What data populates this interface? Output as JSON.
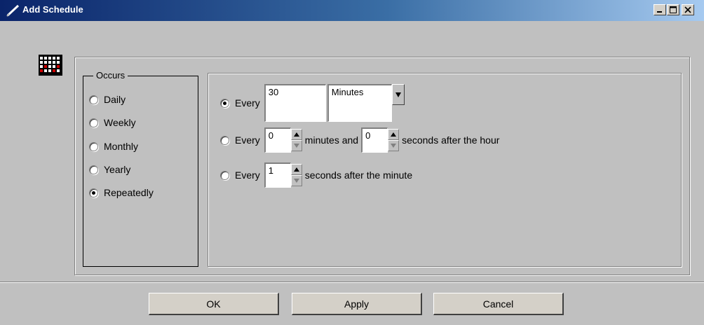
{
  "window": {
    "title": "Add Schedule",
    "icon": "pen-icon",
    "controls": [
      "minimize-icon",
      "maximize-icon",
      "close-icon"
    ]
  },
  "occurs": {
    "legend": "Occurs",
    "options": [
      {
        "label": "Daily",
        "checked": false
      },
      {
        "label": "Weekly",
        "checked": false
      },
      {
        "label": "Monthly",
        "checked": false
      },
      {
        "label": "Yearly",
        "checked": false
      },
      {
        "label": "Repeatedly",
        "checked": true
      }
    ]
  },
  "repeat": {
    "row1": {
      "label": "Every",
      "value": "30",
      "unit": "Minutes",
      "checked": true
    },
    "row2": {
      "label": "Every",
      "minutes": "0",
      "mid_text": "minutes and",
      "seconds": "0",
      "end_text": "seconds after the hour",
      "checked": false
    },
    "row3": {
      "label": "Every",
      "seconds": "1",
      "end_text": "seconds after the minute",
      "checked": false
    }
  },
  "buttons": {
    "ok": "OK",
    "apply": "Apply",
    "cancel": "Cancel"
  },
  "colors": {
    "titlebar_start": "#0a246a",
    "titlebar_end": "#a6caf0",
    "face": "#c0c0c0",
    "calendar_mark": "#cc0000"
  }
}
